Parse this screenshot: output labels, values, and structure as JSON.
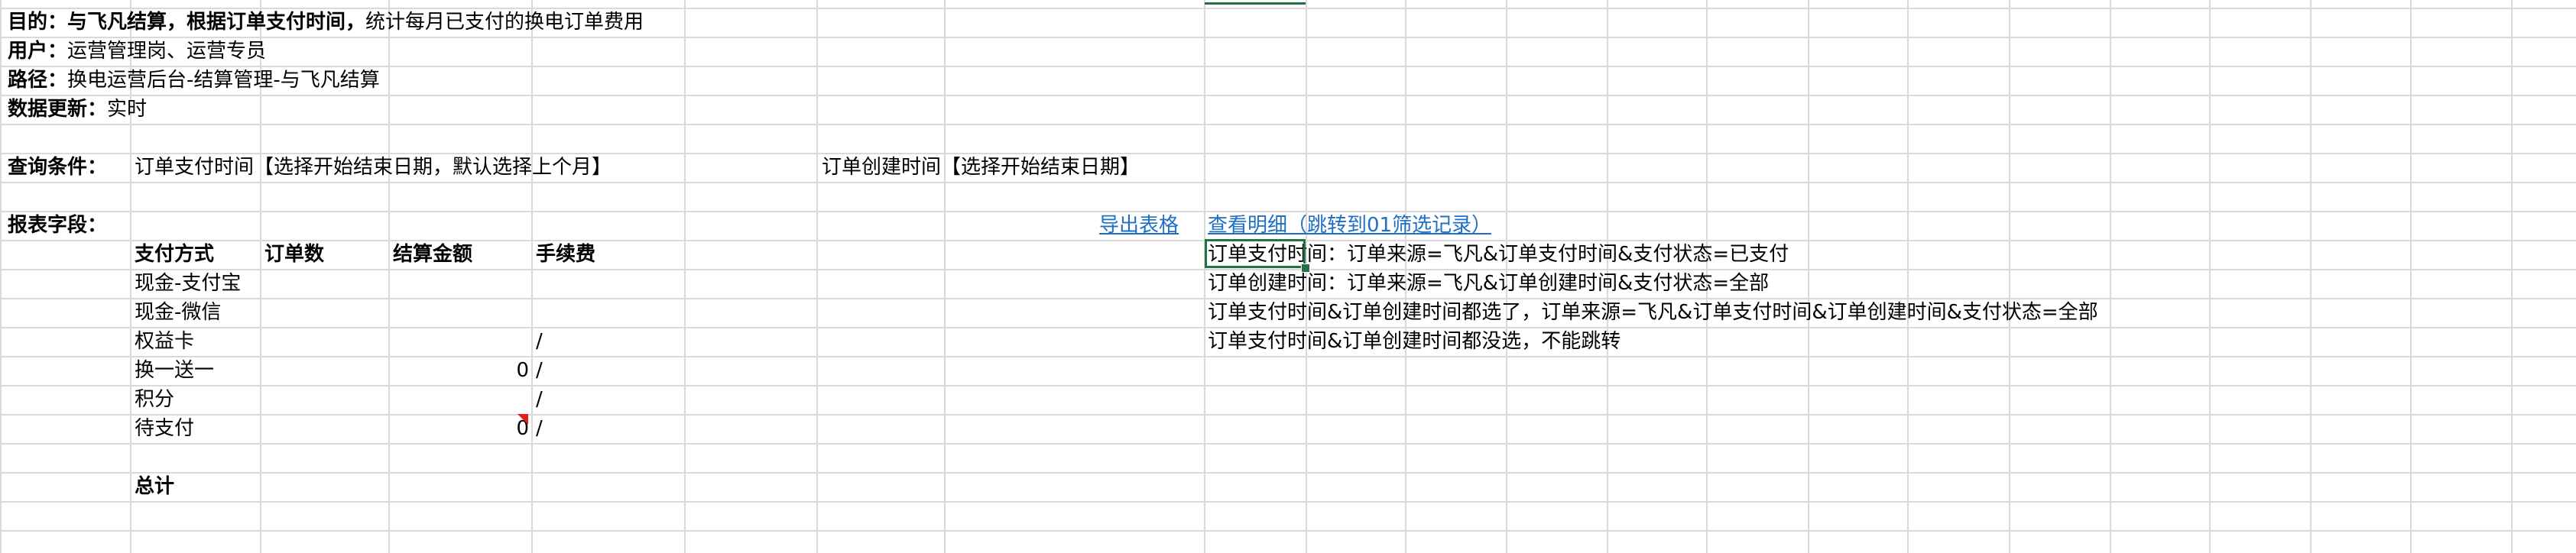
{
  "header": {
    "goal_label": "目的：",
    "goal_bold": "与飞凡结算，根据订单支付时间，",
    "goal_rest": "统计每月已支付的换电订单费用",
    "user_label": "用户：",
    "user_value": "运营管理岗、运营专员",
    "path_label": "路径：",
    "path_value": "换电运营后台-结算管理-与飞凡结算",
    "update_label": "数据更新：",
    "update_value": "实时"
  },
  "query": {
    "label": "查询条件：",
    "pay_time": "订单支付时间【选择开始结束日期，默认选择上个月】",
    "create_time": "订单创建时间【选择开始结束日期】"
  },
  "report": {
    "label": "报表字段：",
    "export_link": "导出表格",
    "detail_link": "查看明细（跳转到01筛选记录）"
  },
  "table": {
    "columns": [
      "支付方式",
      "订单数",
      "结算金额",
      "手续费"
    ],
    "rows": [
      {
        "method": "现金-支付宝",
        "count": "",
        "amount": "",
        "fee": ""
      },
      {
        "method": "现金-微信",
        "count": "",
        "amount": "",
        "fee": ""
      },
      {
        "method": "权益卡",
        "count": "",
        "amount": "",
        "fee": "/"
      },
      {
        "method": "换一送一",
        "count": "",
        "amount": "0",
        "fee": "/"
      },
      {
        "method": "积分",
        "count": "",
        "amount": "",
        "fee": "/"
      },
      {
        "method": "待支付",
        "count": "",
        "amount": "0",
        "fee": "/"
      }
    ],
    "total_label": "总计"
  },
  "notes": [
    "订单支付时间：订单来源=飞凡&订单支付时间&支付状态=已支付",
    "订单创建时间：订单来源=飞凡&订单创建时间&支付状态=全部",
    "订单支付时间&订单创建时间都选了，订单来源=飞凡&订单支付时间&订单创建时间&支付状态=全部",
    "订单支付时间&订单创建时间都没选，不能跳转"
  ],
  "colors": {
    "grid": "#d9d9d9",
    "link": "#1f6fc5",
    "selection": "#217346",
    "comment": "#e0211b"
  }
}
